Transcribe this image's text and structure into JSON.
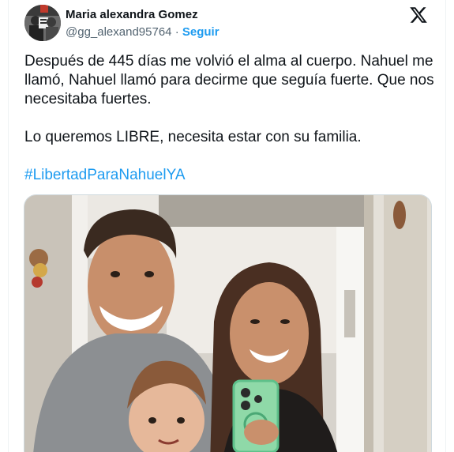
{
  "author": {
    "name": "Maria alexandra Gomez",
    "handle": "@gg_alexand95764",
    "separator": "·",
    "follow_label": "Seguir"
  },
  "tweet": {
    "paragraph1": "Después de 445 días me volvió el alma al cuerpo. Nahuel me llamó, Nahuel llamó para decirme que seguía fuerte. Que nos necesitaba fuertes.",
    "paragraph2": "Lo queremos LIBRE, necesita estar con su familia.",
    "hashtag": "#LibertadParaNahuelYA"
  },
  "icons": {
    "platform_logo": "x-logo-icon"
  },
  "colors": {
    "link": "#1d9bf0",
    "text": "#0f1419",
    "secondary": "#536471"
  }
}
